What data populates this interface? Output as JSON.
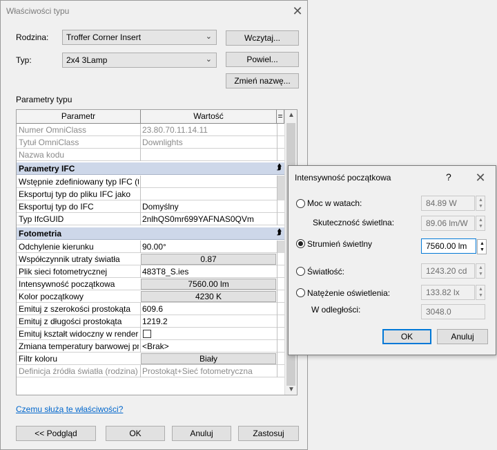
{
  "main": {
    "title": "Właściwości typu",
    "family_label": "Rodzina:",
    "family_value": "Troffer Corner Insert",
    "type_label": "Typ:",
    "type_value": "2x4 3Lamp",
    "load_button": "Wczytaj...",
    "duplicate_button": "Powiel...",
    "rename_button": "Zmień nazwę...",
    "section_title": "Parametry typu",
    "col_param": "Parametr",
    "col_value": "Wartość",
    "col_extra": "=",
    "help_link": "Czemu służą te właściwości?",
    "preview_button": "<< Podgląd",
    "ok_button": "OK",
    "cancel_button": "Anuluj",
    "apply_button": "Zastosuj"
  },
  "grid": {
    "rows_top": [
      {
        "param": "Numer OmniClass",
        "value": "23.80.70.11.14.11"
      },
      {
        "param": "Tytuł OmniClass",
        "value": "Downlights"
      },
      {
        "param": "Nazwa kodu",
        "value": ""
      }
    ],
    "group_ifc": "Parametry IFC",
    "rows_ifc": [
      {
        "param": "Wstępnie zdefiniowany typ IFC (t",
        "value": ""
      },
      {
        "param": "Eksportuj typ do pliku IFC jako",
        "value": ""
      },
      {
        "param": "Eksportuj typ do IFC",
        "value": "Domyślny"
      },
      {
        "param": "Typ IfcGUID",
        "value": "2nlhQS0mr699YAFNAS0QVm"
      }
    ],
    "group_photometry": "Fotometria",
    "rows_photo": [
      {
        "param": "Odchylenie kierunku",
        "value": "90.00°"
      },
      {
        "param": "Współczynnik utraty światła",
        "value": "0.87"
      },
      {
        "param": "Plik sieci fotometrycznej",
        "value": "483T8_S.ies"
      },
      {
        "param": "Intensywność początkowa",
        "value": "7560.00 lm"
      },
      {
        "param": "Kolor początkowy",
        "value": "4230 K"
      },
      {
        "param": "Emituj z szerokości prostokąta",
        "value": "609.6"
      },
      {
        "param": "Emituj z długości prostokąta",
        "value": "1219.2"
      },
      {
        "param": "Emituj kształt widoczny w renderi",
        "value": ""
      },
      {
        "param": "Zmiana temperatury barwowej pr",
        "value": "<Brak>"
      },
      {
        "param": "Filtr koloru",
        "value": "Biały"
      },
      {
        "param": "Definicja źródła światła (rodzina)",
        "value": "Prostokąt+Sieć fotometryczna"
      }
    ]
  },
  "dialog": {
    "title": "Intensywność początkowa",
    "help": "?",
    "opt_wattage": "Moc w watach:",
    "wattage_value": "84.89 W",
    "efficacy_label": "Skuteczność świetlna:",
    "efficacy_value": "89.06 lm/W",
    "opt_flux": "Strumień świetlny",
    "flux_value": "7560.00 lm",
    "opt_intensity": "Światłość:",
    "intensity_value": "1243.20 cd",
    "opt_illuminance": "Natężenie oświetlenia:",
    "illuminance_value": "133.82 lx",
    "distance_label": "W odległości:",
    "distance_value": "3048.0",
    "ok_button": "OK",
    "cancel_button": "Anuluj",
    "selected_option": "flux"
  },
  "colors": {
    "group_header": "#cdd7e9",
    "focus_accent": "#0078d7",
    "link": "#0066cc"
  }
}
